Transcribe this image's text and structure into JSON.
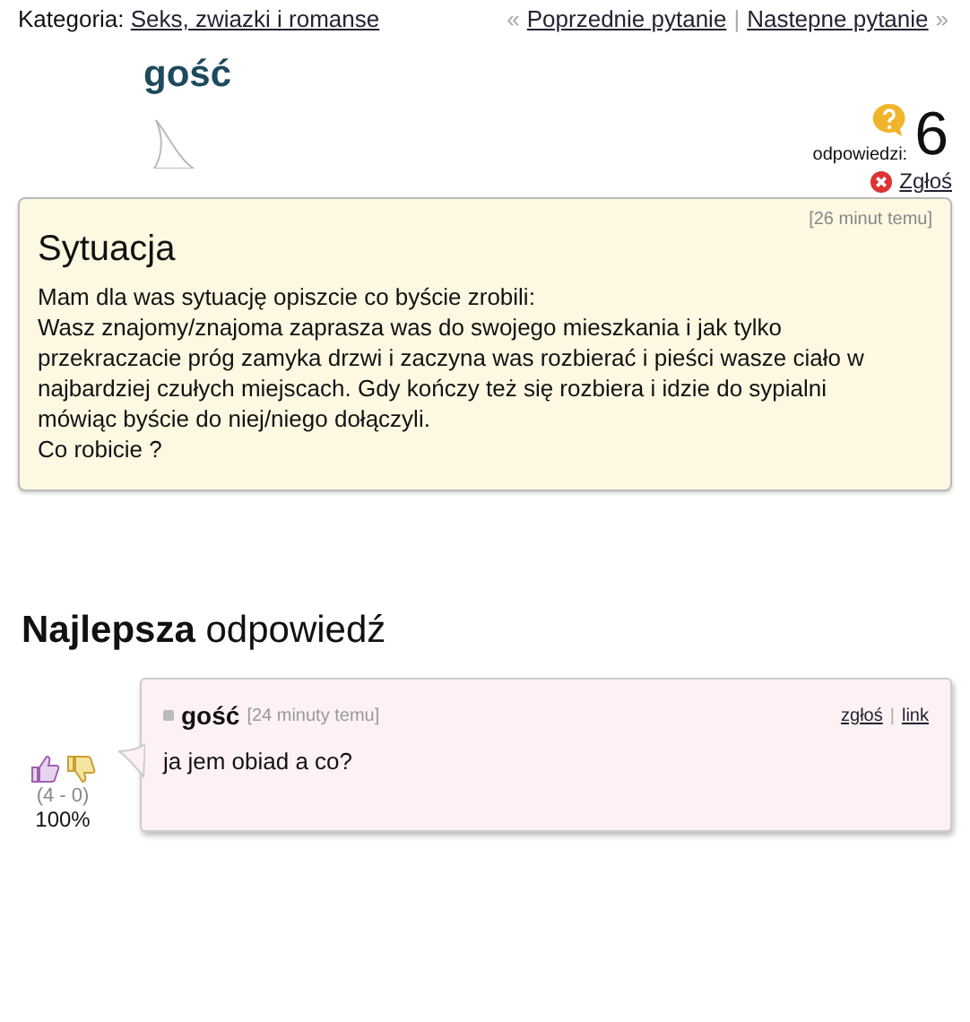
{
  "category": {
    "label": "Kategoria:",
    "link": "Seks, zwiazki i romanse"
  },
  "nav": {
    "prev_mark": "«",
    "prev": "Poprzednie pytanie",
    "separator": "|",
    "next": "Nastepne pytanie",
    "next_mark": "»"
  },
  "asker": {
    "name": "gość",
    "answers_label": "odpowiedzi:",
    "answers_count": "6",
    "report": "Zgłoś"
  },
  "question": {
    "time": "[26 minut temu]",
    "title": "Sytuacja",
    "paragraphs": [
      "Mam dla was sytuację opiszcie co byście zrobili:",
      "Wasz znajomy/znajoma zaprasza was do swojego mieszkania i jak tylko przekraczacie próg zamyka drzwi i zaczyna was rozbierać i pieści wasze ciało w najbardziej czułych miejscach. Gdy kończy też się rozbiera i idzie do sypialni mówiąc byście do niej/niego dołączyli.",
      "Co robicie ?"
    ]
  },
  "best_answer": {
    "heading": "**Najlepsza** odpowiedź",
    "votes": "(4 - 0)",
    "percent": "100%",
    "author": "gość",
    "time": "[24 minuty temu]",
    "report": "zgłoś",
    "separator": "|",
    "link": "link",
    "text": "ja jem obiad a co?"
  }
}
